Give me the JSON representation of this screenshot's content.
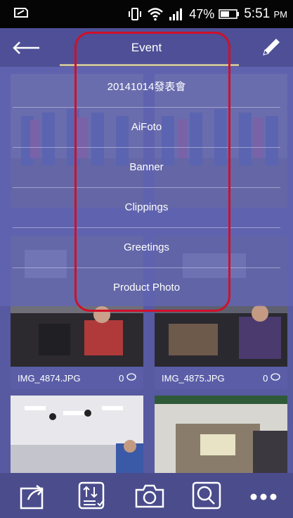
{
  "status_bar": {
    "battery_pct": "47%",
    "time": "5:51",
    "ampm": "PM"
  },
  "app_bar": {
    "title": "Event"
  },
  "menu": {
    "items": [
      "20141014發表會",
      "AiFoto",
      "Banner",
      "Clippings",
      "Greetings",
      "Product Photo"
    ]
  },
  "gallery": {
    "tiles": [
      {
        "name": "IMG_4874.JPG",
        "count": "0"
      },
      {
        "name": "IMG_4875.JPG",
        "count": "0"
      }
    ]
  },
  "icons": [
    "back-arrow-icon",
    "pencil-edit-icon",
    "share-icon",
    "sort-icon",
    "camera-icon",
    "search-icon",
    "more-icon"
  ]
}
